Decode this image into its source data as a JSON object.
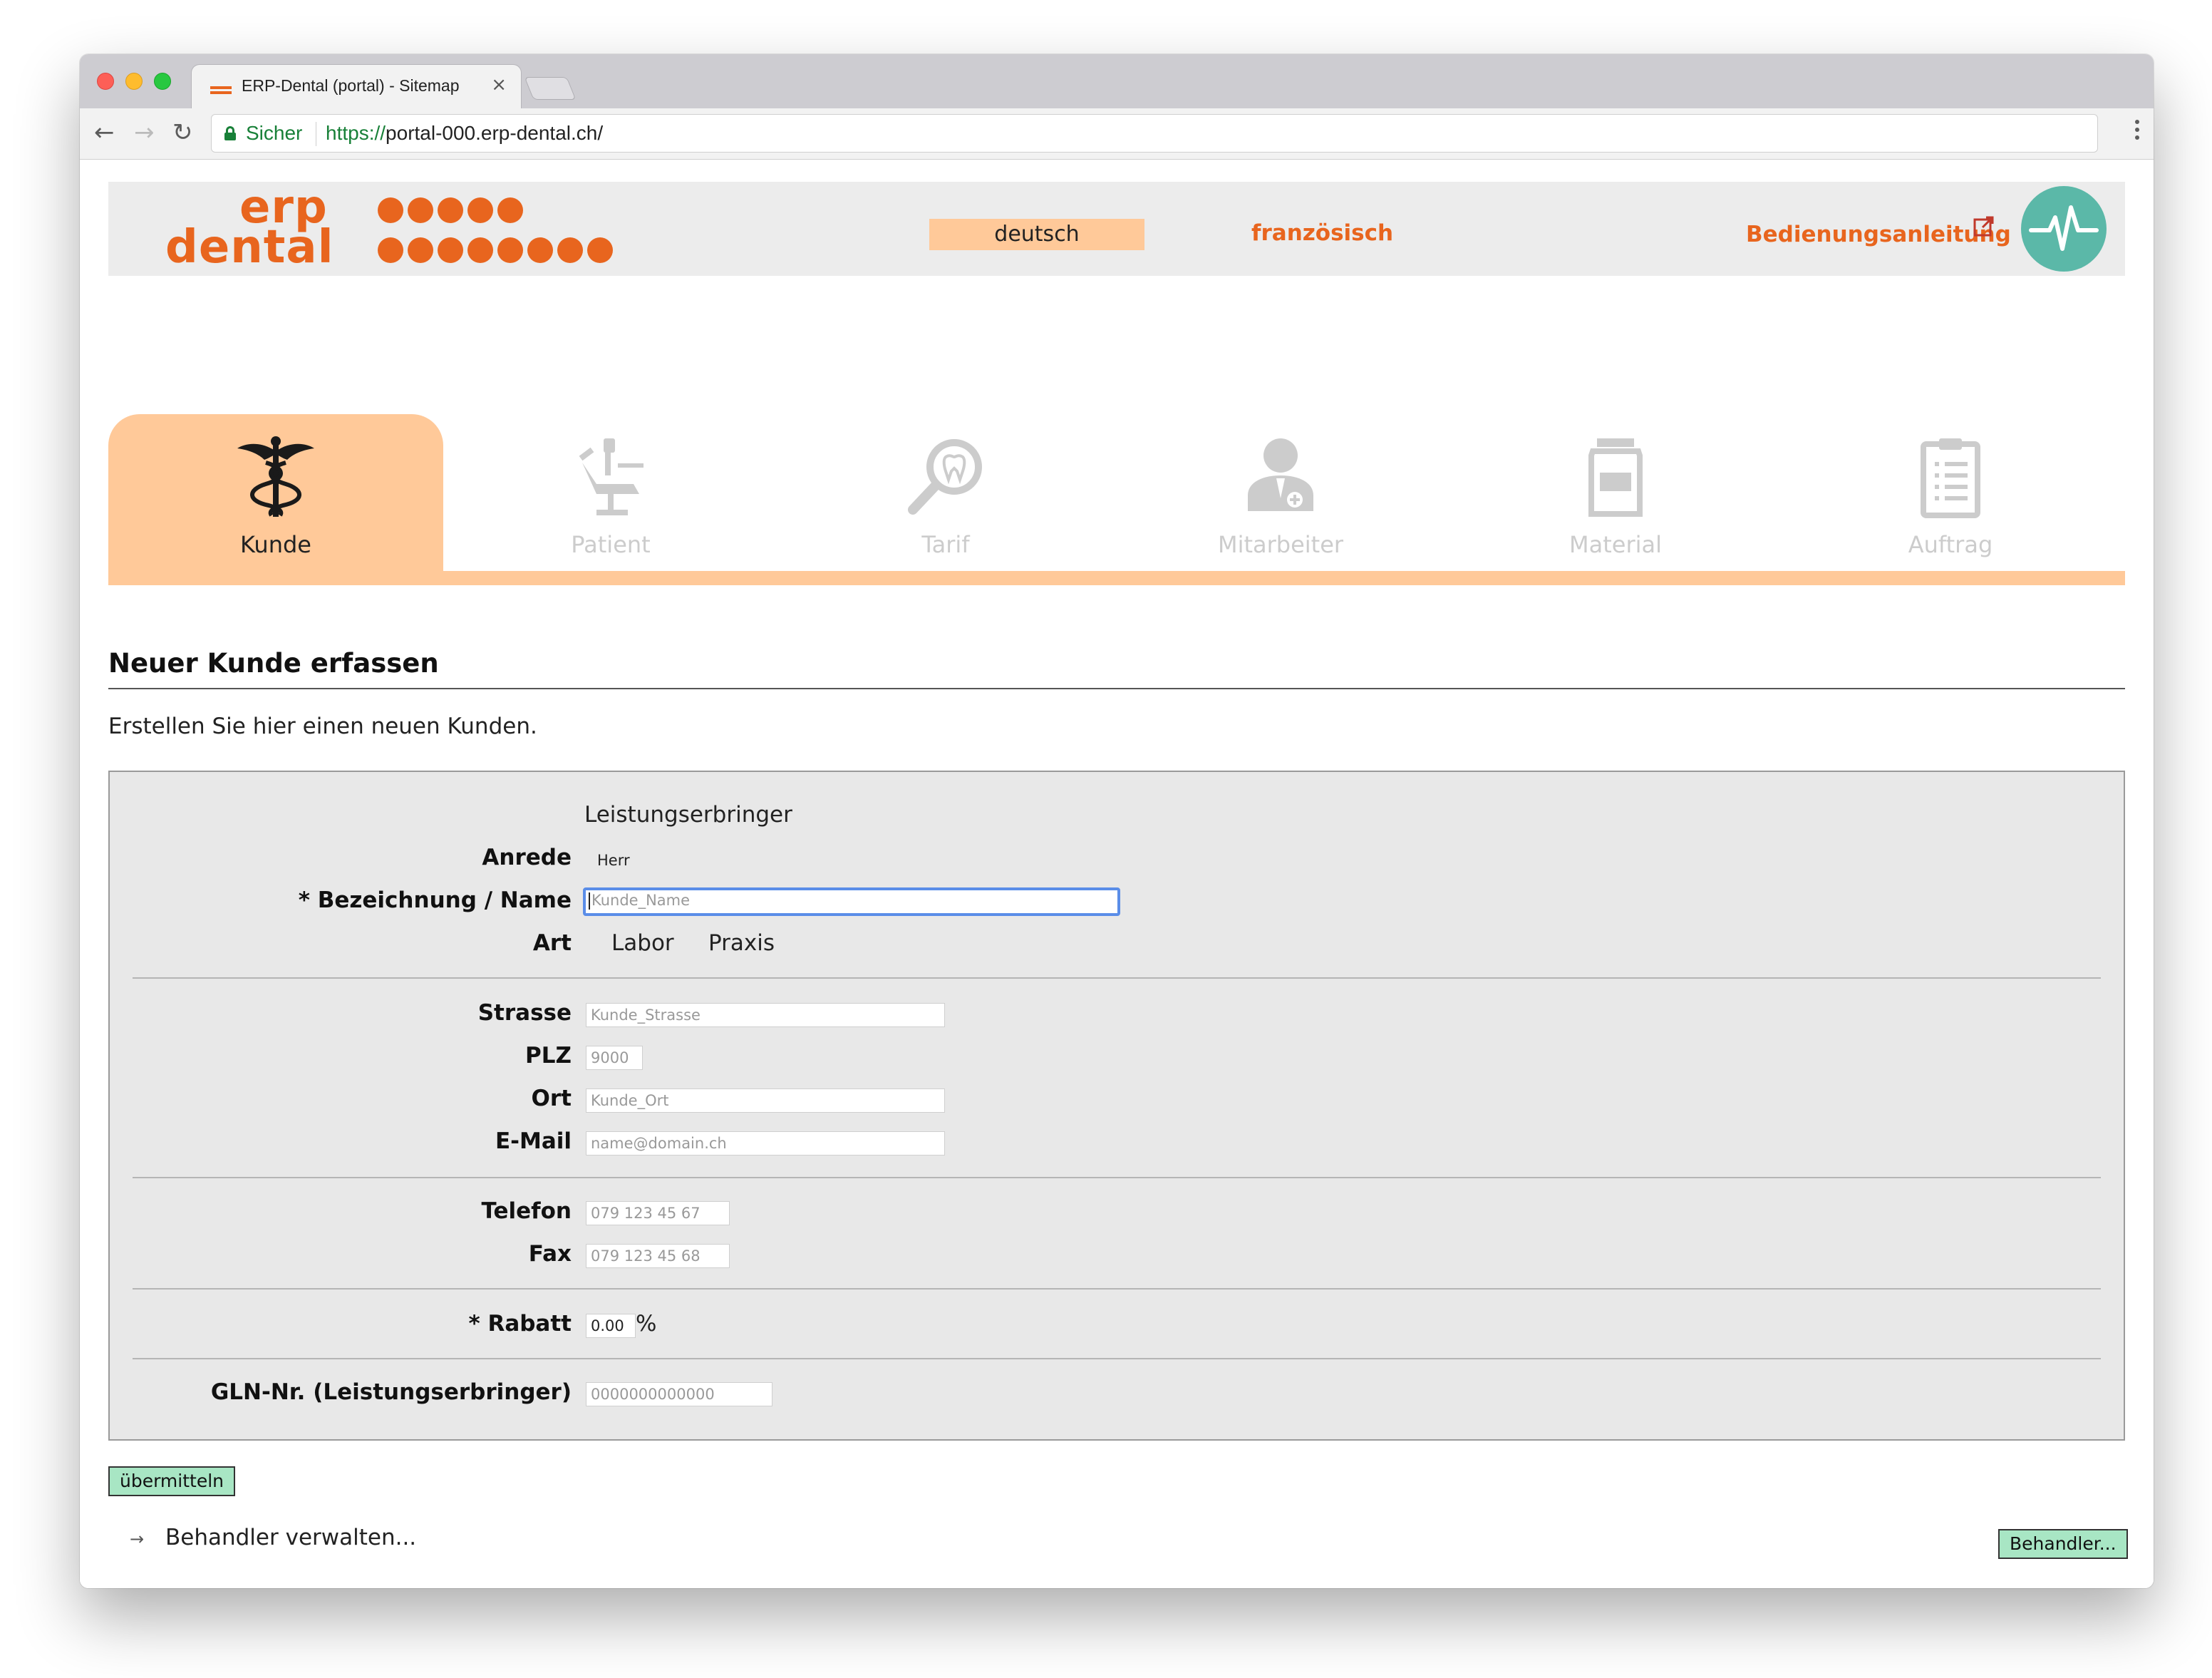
{
  "browser": {
    "tab_title": "ERP-Dental (portal) - Sitemap",
    "tab_close": "×",
    "secure_label": "Sicher",
    "url_scheme": "https://",
    "url_rest": "portal-000.erp-dental.ch/"
  },
  "header": {
    "logo_line1": "erp",
    "logo_line2": "dental",
    "lang_active": "deutsch",
    "lang_other": "französisch",
    "manual_link": "Bedienungsanleitung"
  },
  "modules": [
    {
      "label": "Kunde",
      "icon": "caduceus-icon",
      "active": true
    },
    {
      "label": "Patient",
      "icon": "dental-chair-icon",
      "active": false
    },
    {
      "label": "Tarif",
      "icon": "tooth-magnifier-icon",
      "active": false
    },
    {
      "label": "Mitarbeiter",
      "icon": "doctor-icon",
      "active": false
    },
    {
      "label": "Material",
      "icon": "material-jar-icon",
      "active": false
    },
    {
      "label": "Auftrag",
      "icon": "clipboard-icon",
      "active": false
    }
  ],
  "content": {
    "title": "Neuer Kunde erfassen",
    "intro": "Erstellen Sie hier einen neuen Kunden."
  },
  "form": {
    "type_value": "Leistungserbringer",
    "anrede_label": "Anrede",
    "anrede_value": "Herr",
    "name_label": "* Bezeichnung / Name",
    "name_placeholder": "Kunde_Name",
    "art_label": "Art",
    "art_options": [
      "Labor",
      "Praxis"
    ],
    "strasse_label": "Strasse",
    "strasse_placeholder": "Kunde_Strasse",
    "plz_label": "PLZ",
    "plz_placeholder": "9000",
    "ort_label": "Ort",
    "ort_placeholder": "Kunde_Ort",
    "email_label": "E-Mail",
    "email_placeholder": "name@domain.ch",
    "telefon_label": "Telefon",
    "telefon_placeholder": "079 123 45 67",
    "fax_label": "Fax",
    "fax_placeholder": "079 123 45 68",
    "rabatt_label": "* Rabatt",
    "rabatt_value": "0.00",
    "rabatt_unit": "%",
    "gln_label": "GLN-Nr. (Leistungserbringer)",
    "gln_placeholder": "0000000000000"
  },
  "actions": {
    "submit_label": "übermitteln",
    "arrow": "→",
    "manage_link": "Behandler verwalten...",
    "behandler_button": "Behandler..."
  },
  "colors": {
    "accent": "#e8651e",
    "tab_active": "#ffc999",
    "button_green": "#a8e6c4",
    "pulse": "#5bb8a8"
  }
}
